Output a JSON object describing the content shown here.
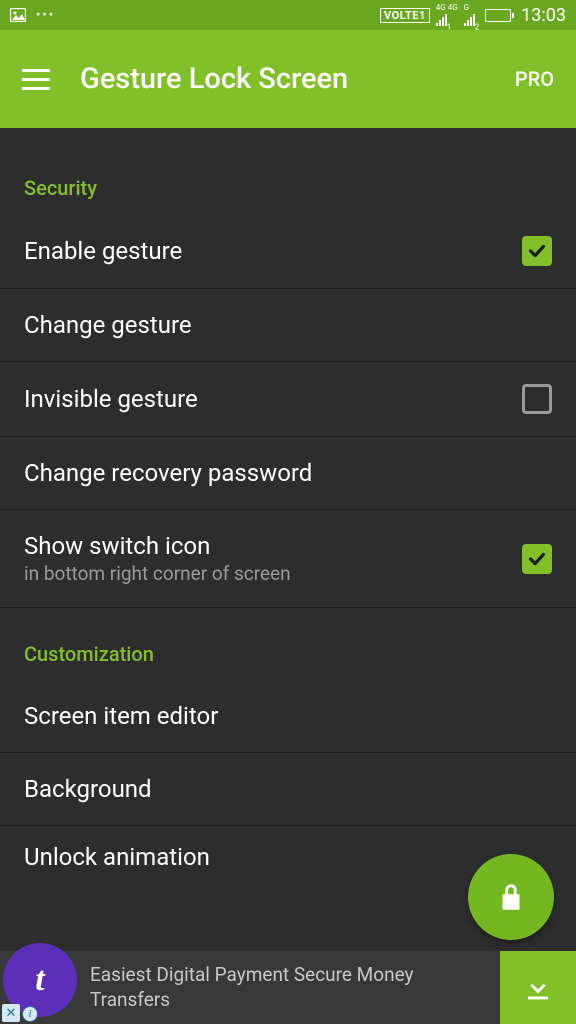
{
  "statusbar": {
    "volte": "VOLTE1",
    "net": "4G 4G",
    "sub1": "1",
    "sub2": "2",
    "g": "G",
    "time": "13:03"
  },
  "appbar": {
    "title": "Gesture Lock Screen",
    "pro": "PRO"
  },
  "sections": {
    "security": "Security",
    "customization": "Customization"
  },
  "rows": {
    "enable_gesture": "Enable gesture",
    "change_gesture": "Change gesture",
    "invisible_gesture": "Invisible gesture",
    "change_recovery": "Change recovery password",
    "show_switch": "Show switch icon",
    "show_switch_sub": "in bottom right corner of screen",
    "screen_editor": "Screen item editor",
    "background": "Background",
    "unlock_anim": "Unlock animation"
  },
  "checks": {
    "enable_gesture": true,
    "invisible_gesture": false,
    "show_switch": true
  },
  "ad": {
    "logo_letter": "t",
    "text": "Easiest Digital Payment Secure Money Transfers"
  }
}
